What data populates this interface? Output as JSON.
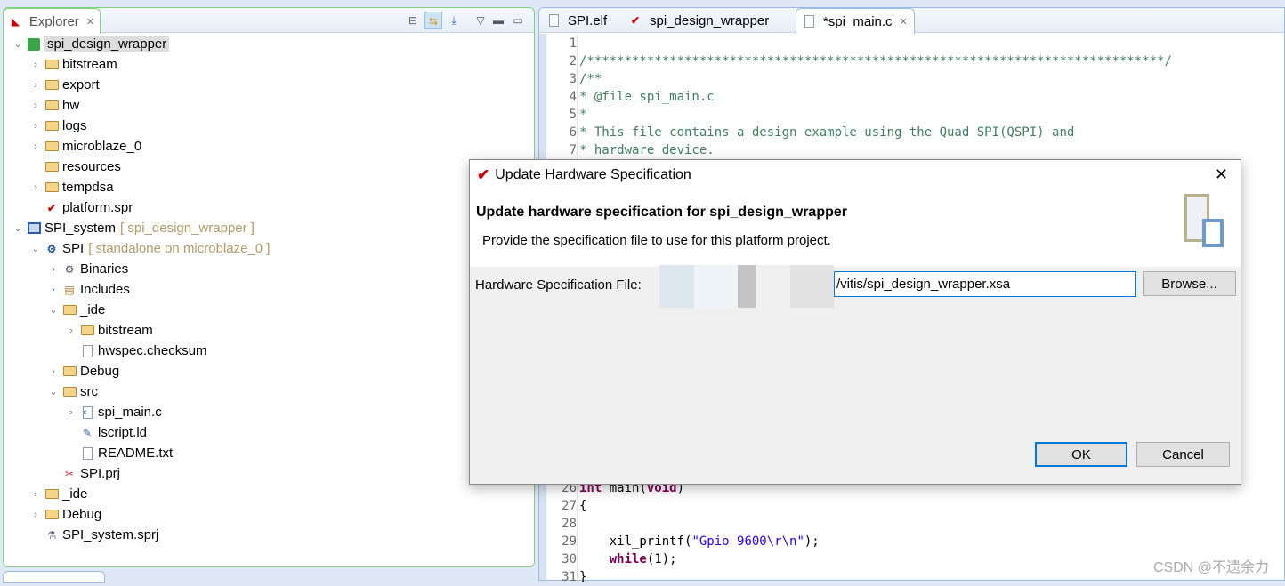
{
  "explorer": {
    "tab_label": "Explorer",
    "tree": [
      {
        "level": 0,
        "chev": "v",
        "icon": "platform",
        "label": "spi_design_wrapper",
        "selected": true
      },
      {
        "level": 1,
        "chev": ">",
        "icon": "folder",
        "label": "bitstream"
      },
      {
        "level": 1,
        "chev": ">",
        "icon": "folder",
        "label": "export"
      },
      {
        "level": 1,
        "chev": ">",
        "icon": "folder",
        "label": "hw"
      },
      {
        "level": 1,
        "chev": ">",
        "icon": "folder",
        "label": "logs"
      },
      {
        "level": 1,
        "chev": ">",
        "icon": "folder",
        "label": "microblaze_0"
      },
      {
        "level": 1,
        "chev": "",
        "icon": "folder",
        "label": "resources"
      },
      {
        "level": 1,
        "chev": ">",
        "icon": "folder",
        "label": "tempdsa"
      },
      {
        "level": 1,
        "chev": "",
        "icon": "vitis",
        "label": "platform.spr"
      },
      {
        "level": 0,
        "chev": "v",
        "icon": "system",
        "label": "SPI_system",
        "suffix": "[ spi_design_wrapper ]"
      },
      {
        "level": 1,
        "chev": "v",
        "icon": "app",
        "label": "SPI",
        "suffix": "[ standalone on microblaze_0 ]"
      },
      {
        "level": 2,
        "chev": ">",
        "icon": "binaries",
        "label": "Binaries"
      },
      {
        "level": 2,
        "chev": ">",
        "icon": "includes",
        "label": "Includes"
      },
      {
        "level": 2,
        "chev": "v",
        "icon": "folder",
        "label": "_ide"
      },
      {
        "level": 3,
        "chev": ">",
        "icon": "folder",
        "label": "bitstream"
      },
      {
        "level": 3,
        "chev": "",
        "icon": "file",
        "label": "hwspec.checksum"
      },
      {
        "level": 2,
        "chev": ">",
        "icon": "folder",
        "label": "Debug"
      },
      {
        "level": 2,
        "chev": "v",
        "icon": "folder",
        "label": "src"
      },
      {
        "level": 3,
        "chev": ">",
        "icon": "c-file",
        "label": "spi_main.c"
      },
      {
        "level": 3,
        "chev": "",
        "icon": "linker",
        "label": "lscript.ld"
      },
      {
        "level": 3,
        "chev": "",
        "icon": "file",
        "label": "README.txt"
      },
      {
        "level": 2,
        "chev": "",
        "icon": "tools",
        "label": "SPI.prj"
      },
      {
        "level": 1,
        "chev": ">",
        "icon": "folder",
        "label": "_ide"
      },
      {
        "level": 1,
        "chev": ">",
        "icon": "folder",
        "label": "Debug"
      },
      {
        "level": 1,
        "chev": "",
        "icon": "flask",
        "label": "SPI_system.sprj"
      }
    ]
  },
  "editor": {
    "tabs": [
      {
        "label": "SPI.elf"
      },
      {
        "label": "spi_design_wrapper"
      },
      {
        "label": "*spi_main.c"
      }
    ],
    "lines": [
      {
        "n": "1",
        "segs": []
      },
      {
        "n": "2",
        "segs": [
          {
            "t": "c-com",
            "s": "/*****************************************************************************/"
          }
        ]
      },
      {
        "n": "3",
        "segs": [
          {
            "t": "c-com",
            "s": "/**"
          }
        ]
      },
      {
        "n": "4",
        "segs": [
          {
            "t": "c-com",
            "s": "* @file spi_main.c"
          }
        ]
      },
      {
        "n": "5",
        "segs": [
          {
            "t": "c-com",
            "s": "*"
          }
        ]
      },
      {
        "n": "6",
        "segs": [
          {
            "t": "c-com",
            "s": "* This file contains a design example using the Quad SPI(QSPI) and"
          }
        ]
      },
      {
        "n": "7",
        "segs": [
          {
            "t": "c-com",
            "s": "* hardware device."
          }
        ]
      },
      {
        "n": "26",
        "segs": [
          {
            "t": "c-kw",
            "s": "int"
          },
          {
            "t": "c-pl",
            "s": " main("
          },
          {
            "t": "c-kw",
            "s": "void"
          },
          {
            "t": "c-pl",
            "s": ")"
          }
        ]
      },
      {
        "n": "27",
        "segs": [
          {
            "t": "c-pl",
            "s": "{"
          }
        ]
      },
      {
        "n": "28",
        "segs": []
      },
      {
        "n": "29",
        "segs": [
          {
            "t": "c-pl",
            "s": "    xil_printf("
          },
          {
            "t": "c-str",
            "s": "\"Gpio 9600\\r\\n\""
          },
          {
            "t": "c-pl",
            "s": ");"
          }
        ]
      },
      {
        "n": "30",
        "segs": [
          {
            "t": "c-pl",
            "s": "    "
          },
          {
            "t": "c-kw",
            "s": "while"
          },
          {
            "t": "c-pl",
            "s": "(1);"
          }
        ]
      },
      {
        "n": "31",
        "segs": [
          {
            "t": "c-pl",
            "s": "}"
          }
        ]
      }
    ]
  },
  "dialog": {
    "title": "Update Hardware Specification",
    "heading": "Update hardware specification for spi_design_wrapper",
    "description": "Provide the specification file to use for this platform project.",
    "field_label": "Hardware Specification File:",
    "field_value": "/vitis/spi_design_wrapper.xsa",
    "browse": "Browse...",
    "ok": "OK",
    "cancel": "Cancel"
  },
  "watermark": "CSDN @不遗余力"
}
